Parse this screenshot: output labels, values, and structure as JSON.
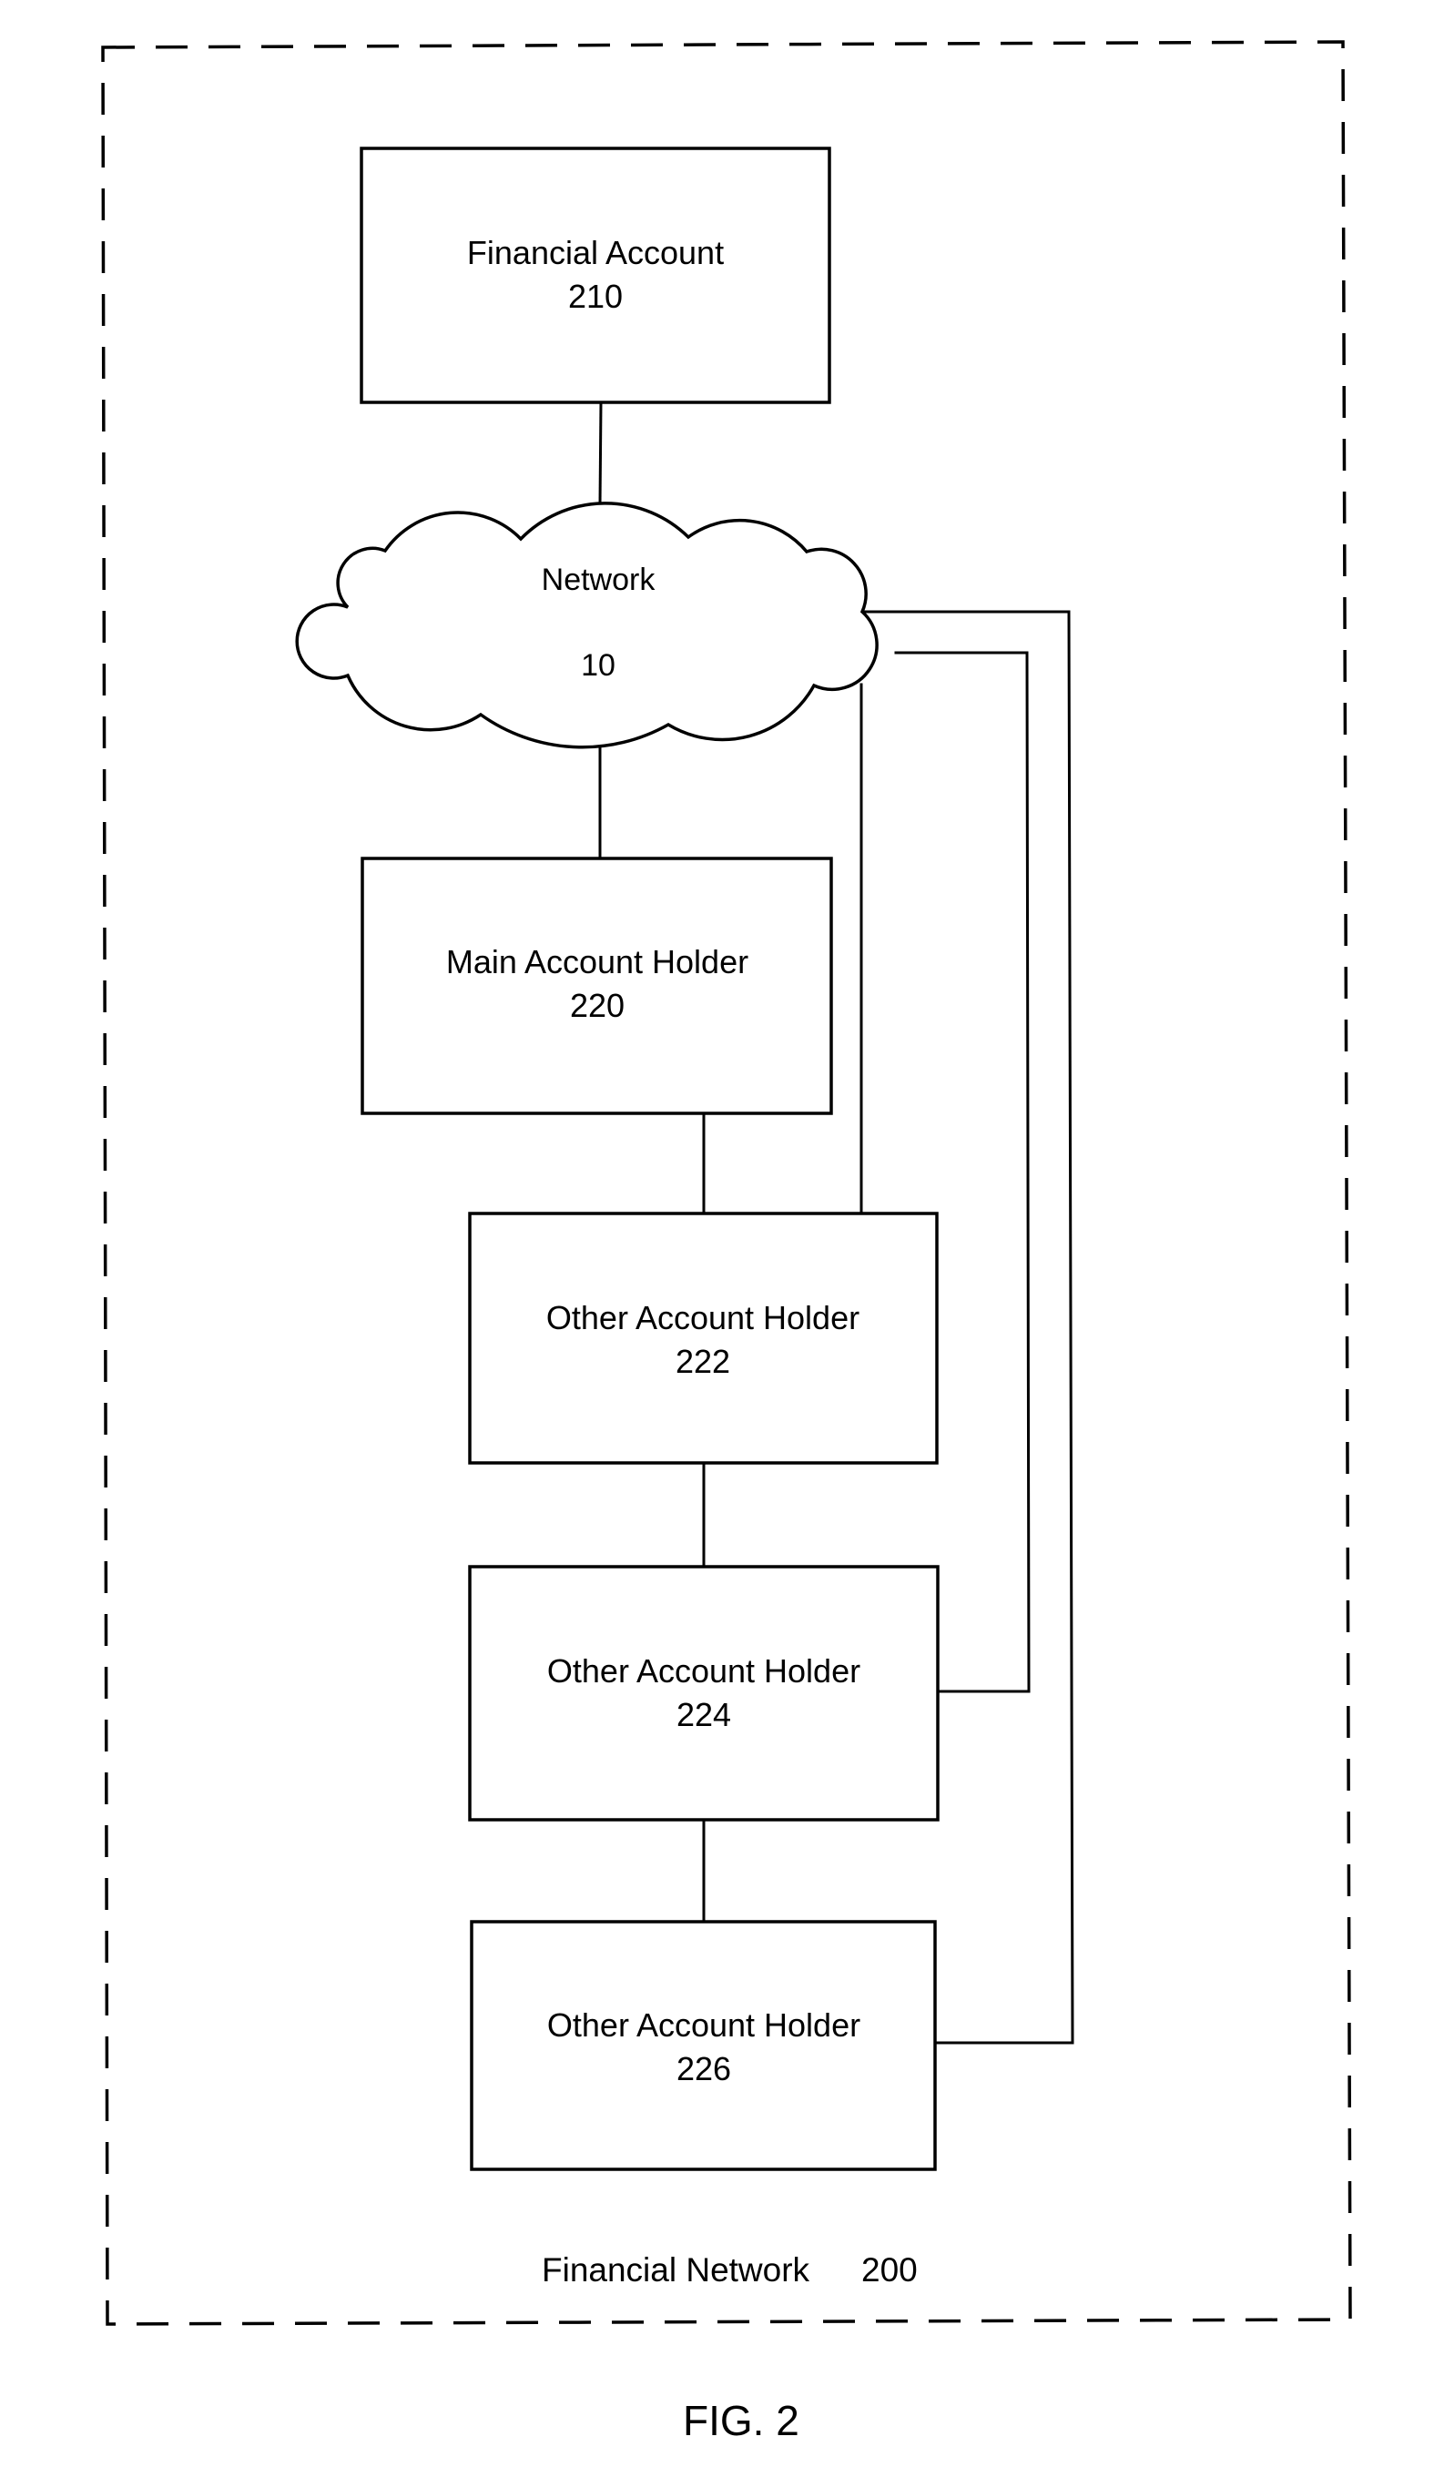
{
  "figure": {
    "caption": "FIG. 2",
    "frame": {
      "label": "Financial Network",
      "ref": "200"
    }
  },
  "nodes": {
    "financial_account": {
      "label": "Financial Account",
      "ref": "210"
    },
    "network": {
      "label": "Network",
      "ref": "10"
    },
    "main_account_holder": {
      "label": "Main Account Holder",
      "ref": "220"
    },
    "other_account_holder_222": {
      "label": "Other Account Holder",
      "ref": "222"
    },
    "other_account_holder_224": {
      "label": "Other Account Holder",
      "ref": "224"
    },
    "other_account_holder_226": {
      "label": "Other Account Holder",
      "ref": "226"
    }
  },
  "connections": [
    {
      "from": "210",
      "to": "10"
    },
    {
      "from": "10",
      "to": "220"
    },
    {
      "from": "220",
      "to": "222"
    },
    {
      "from": "222",
      "to": "224"
    },
    {
      "from": "224",
      "to": "226"
    },
    {
      "from": "10",
      "to": "222"
    },
    {
      "from": "10",
      "to": "224"
    },
    {
      "from": "10",
      "to": "226"
    }
  ]
}
